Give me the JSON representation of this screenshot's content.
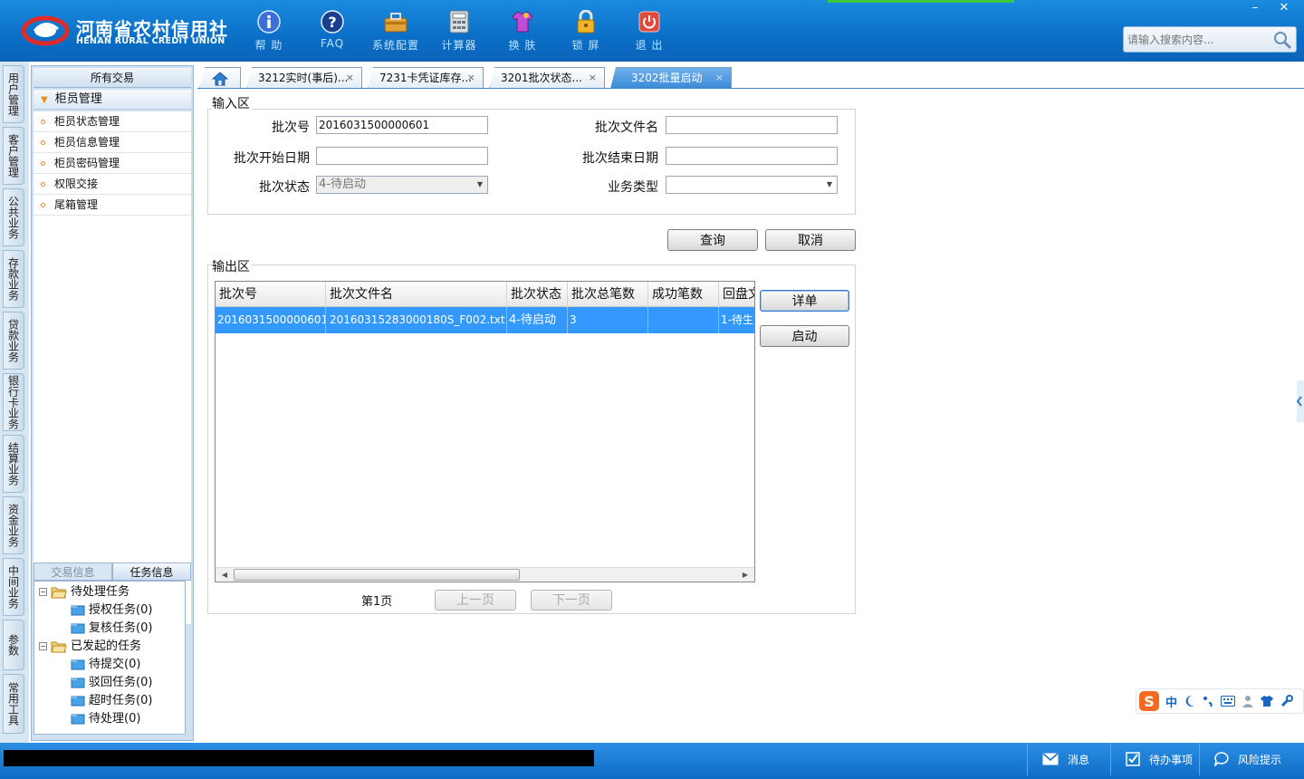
{
  "brand": {
    "name_cn": "河南省农村信用社",
    "name_en": "HENAN RURAL CREDIT UNION",
    "accent_color": "#0b6fc7",
    "highlight_color": "#3399ff"
  },
  "toolbar": {
    "help": "帮 助",
    "faq": "FAQ",
    "settings": "系统配置",
    "calculator": "计算器",
    "skin": "换 肤",
    "lock": "锁 屏",
    "exit": "退 出"
  },
  "window": {
    "minimize": "–",
    "close": "✕"
  },
  "search": {
    "placeholder": "请输入搜索内容..."
  },
  "vnav": {
    "user_mgmt": "用户管理",
    "customer_mgmt": "客户管理",
    "public_biz": "公共业务",
    "deposit_biz": "存款业务",
    "loan_biz": "贷款业务",
    "card_biz": "银行卡业务",
    "settle_biz": "结算业务",
    "fund_biz": "资金业务",
    "middle_biz": "中间业务",
    "params": "参数",
    "tools": "常用工具"
  },
  "sidebar": {
    "header": "所有交易",
    "group": "柜员管理",
    "items": {
      "status": "柜员状态管理",
      "info": "柜员信息管理",
      "password": "柜员密码管理",
      "handover": "权限交接",
      "tailbox": "尾箱管理"
    },
    "tab_trans": "交易信息",
    "tab_task": "任务信息",
    "tree": {
      "pending": "待处理任务",
      "auth": "授权任务(0)",
      "review": "复核任务(0)",
      "initiated": "已发起的任务",
      "to_submit": "待提交(0)",
      "rejected": "驳回任务(0)",
      "timeout": "超时任务(0)",
      "to_process": "待处理(0)"
    }
  },
  "tabs": {
    "t1": "3212实时(事后)...",
    "t2": "7231卡凭证库存...",
    "t3": "3201批次状态...",
    "t4": "3202批量启动",
    "close": "×"
  },
  "input_area": {
    "title": "输入区",
    "batch_no_label": "批次号",
    "batch_no_value": "2016031500000601",
    "batch_file_label": "批次文件名",
    "batch_file_value": "",
    "start_date_label": "批次开始日期",
    "start_date_value": "",
    "end_date_label": "批次结束日期",
    "end_date_value": "",
    "status_label": "批次状态",
    "status_value": "4-待启动",
    "biz_type_label": "业务类型",
    "biz_type_value": ""
  },
  "actions": {
    "query": "查询",
    "cancel": "取消",
    "detail": "详单",
    "start": "启动"
  },
  "output_area": {
    "title": "输出区",
    "columns": {
      "batch_no": "批次号",
      "file_name": "批次文件名",
      "status": "批次状态",
      "total": "批次总笔数",
      "success": "成功笔数",
      "reply": "回盘文"
    },
    "rows": [
      {
        "batch_no": "2016031500000601",
        "file_name": "20160315283000180S_F002.txt",
        "status": "4-待启动",
        "total": "3",
        "success": "",
        "reply": "1-待生"
      }
    ]
  },
  "pagination": {
    "page": "第1页",
    "prev": "上一页",
    "next": "下一页"
  },
  "ime": {
    "lang": "中"
  },
  "status": {
    "messages": "消息",
    "todo": "待办事项",
    "risk": "风险提示"
  }
}
